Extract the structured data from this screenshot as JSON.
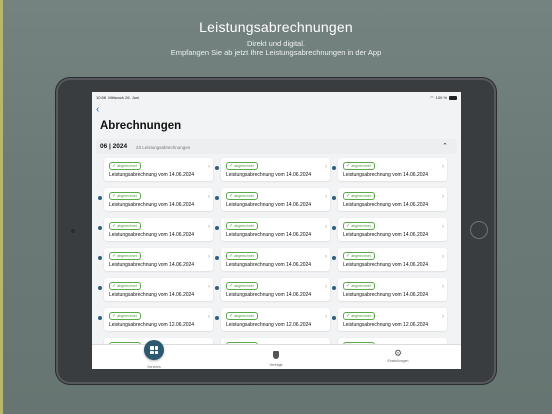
{
  "promo": {
    "headline": "Leistungsabrechnungen",
    "line1": "Direkt und digital.",
    "line2": "Empfangen Sie ab jetzt Ihre Leistungsabrechnungen in der App"
  },
  "status_bar": {
    "time": "10:58",
    "date": "Mittwoch 26. Juni",
    "battery": "100 %"
  },
  "nav": {
    "back_symbol": "‹"
  },
  "page": {
    "title": "Abrechnungen"
  },
  "group": {
    "month": "06 | 2024",
    "count": "23 Leistungsabrechnungen"
  },
  "cards": [
    {
      "status": "abgerechnet",
      "title": "Leistungsabrechnung vom 14.06.2024",
      "unread": false
    },
    {
      "status": "abgerechnet",
      "title": "Leistungsabrechnung vom 14.06.2024",
      "unread": true
    },
    {
      "status": "abgerechnet",
      "title": "Leistungsabrechnung vom 14.06.2024",
      "unread": true
    },
    {
      "status": "abgerechnet",
      "title": "Leistungsabrechnung vom 14.06.2024",
      "unread": true
    },
    {
      "status": "abgerechnet",
      "title": "Leistungsabrechnung vom 14.06.2024",
      "unread": true
    },
    {
      "status": "abgerechnet",
      "title": "Leistungsabrechnung vom 14.06.2024",
      "unread": true
    },
    {
      "status": "abgerechnet",
      "title": "Leistungsabrechnung vom 14.06.2024",
      "unread": true
    },
    {
      "status": "abgerechnet",
      "title": "Leistungsabrechnung vom 14.06.2024",
      "unread": true
    },
    {
      "status": "abgerechnet",
      "title": "Leistungsabrechnung vom 14.06.2024",
      "unread": true
    },
    {
      "status": "abgerechnet",
      "title": "Leistungsabrechnung vom 14.06.2024",
      "unread": true
    },
    {
      "status": "abgerechnet",
      "title": "Leistungsabrechnung vom 14.06.2024",
      "unread": true
    },
    {
      "status": "abgerechnet",
      "title": "Leistungsabrechnung vom 14.06.2024",
      "unread": true
    },
    {
      "status": "abgerechnet",
      "title": "Leistungsabrechnung vom 14.06.2024",
      "unread": true
    },
    {
      "status": "abgerechnet",
      "title": "Leistungsabrechnung vom 14.06.2024",
      "unread": true
    },
    {
      "status": "abgerechnet",
      "title": "Leistungsabrechnung vom 14.06.2024",
      "unread": true
    },
    {
      "status": "abgerechnet",
      "title": "Leistungsabrechnung vom 12.06.2024",
      "unread": true
    },
    {
      "status": "abgerechnet",
      "title": "Leistungsabrechnung vom 12.06.2024",
      "unread": true
    },
    {
      "status": "abgerechnet",
      "title": "Leistungsabrechnung vom 12.06.2024",
      "unread": true
    },
    {
      "status": "abgerechnet",
      "title": "",
      "unread": true
    },
    {
      "status": "abgerechnet",
      "title": "",
      "unread": true
    },
    {
      "status": "abgerechnet",
      "title": "",
      "unread": true
    }
  ],
  "tabbar": {
    "items": [
      {
        "label": "Services",
        "icon": "grid-icon",
        "active": true
      },
      {
        "label": "Verträge",
        "icon": "shield-icon",
        "active": false
      },
      {
        "label": "Einstellungen",
        "icon": "gear-icon",
        "active": false
      }
    ]
  },
  "colors": {
    "accent": "#2c5870",
    "badge_green": "#4f9a3f",
    "unread_dot": "#2f5f7c"
  }
}
